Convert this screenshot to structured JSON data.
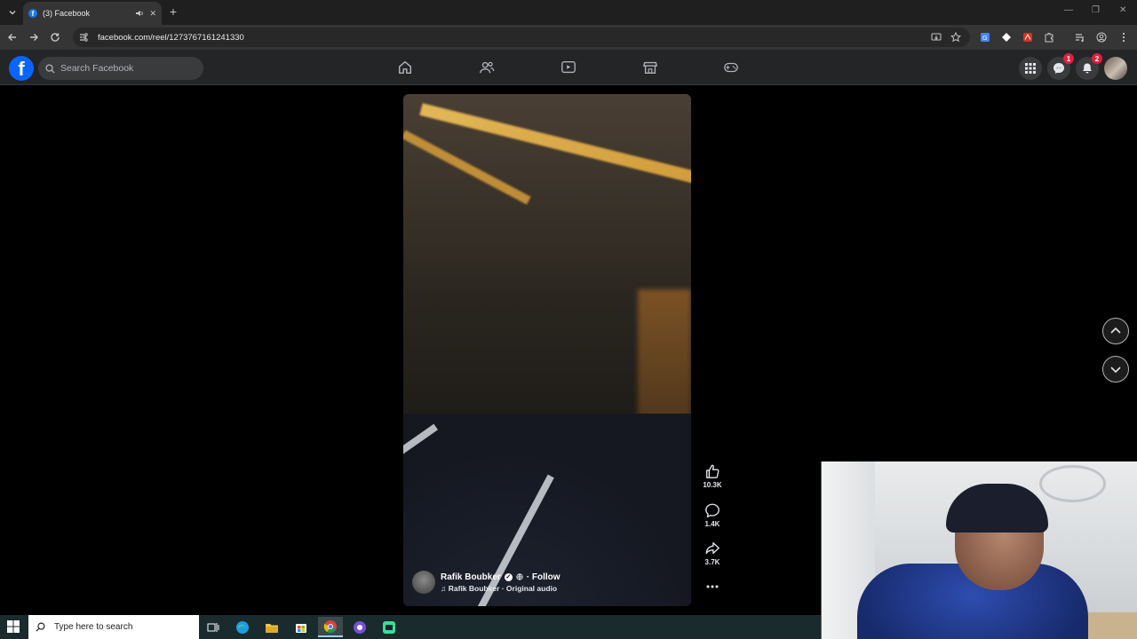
{
  "browser": {
    "tab": {
      "title": "(3) Facebook",
      "favicon": "f"
    },
    "url": "facebook.com/reel/1273767161241330"
  },
  "facebook": {
    "logo": "f",
    "search_placeholder": "Search Facebook",
    "nav_icons": [
      "home-icon",
      "friends-icon",
      "video-icon",
      "marketplace-icon",
      "gaming-icon"
    ],
    "messenger_badge": "1",
    "notifications_badge": "2"
  },
  "reel": {
    "author": "Rafik Boubker",
    "follow_label": "· Follow",
    "audio": "Rafik Boubker · Original audio",
    "likes": "10.3K",
    "comments": "1.4K",
    "shares": "3.7K"
  },
  "taskbar": {
    "search_placeholder": "Type here to search"
  },
  "colors": {
    "fb_blue": "#0866ff",
    "badge_red": "#e41e3f",
    "header_bg": "#242526",
    "search_bg": "#3a3b3c"
  }
}
